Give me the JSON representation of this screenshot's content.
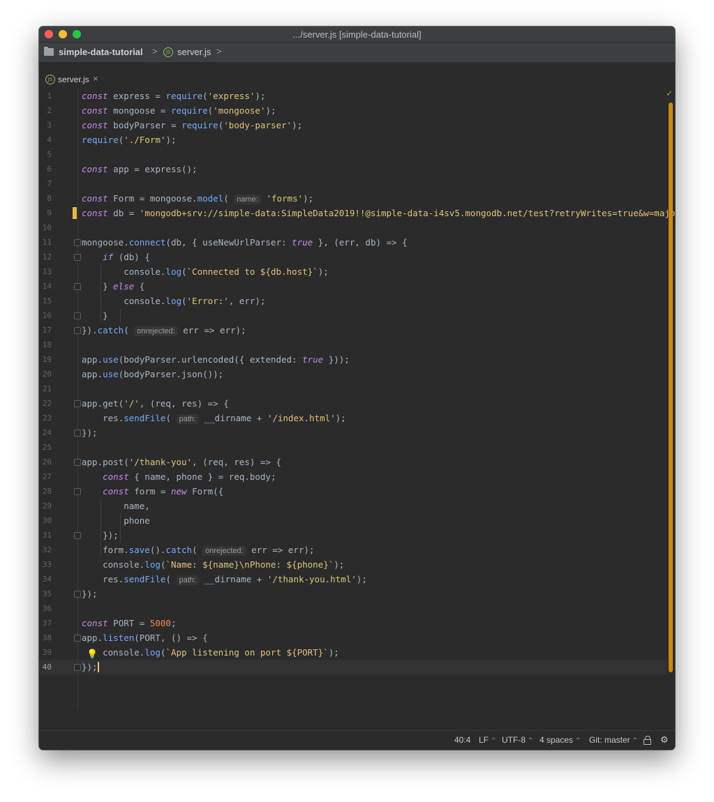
{
  "window": {
    "title": ".../server.js [simple-data-tutorial]"
  },
  "navbar": {
    "project": "simple-data-tutorial",
    "file": "server.js",
    "separator": ">"
  },
  "tab": {
    "label": "server.js",
    "close": "×",
    "icon_text": "JS"
  },
  "editor": {
    "caret_line": 40,
    "lines": [
      "const express = require('express');",
      "const mongoose = require('mongoose');",
      "const bodyParser = require('body-parser');",
      "require('./Form');",
      "",
      "const app = express();",
      "",
      "const Form = mongoose.model( name: 'forms');",
      "const db = 'mongodb+srv://simple-data:SimpleData2019!!@simple-data-i4sv5.mongodb.net/test?retryWrites=true&w=majority';",
      "",
      "mongoose.connect(db, { useNewUrlParser: true }, (err, db) => {",
      "    if (db) {",
      "        console.log(`Connected to ${db.host}`);",
      "    } else {",
      "        console.log('Error:', err);",
      "    }",
      "}).catch( onrejected: err => err);",
      "",
      "app.use(bodyParser.urlencoded({ extended: true }));",
      "app.use(bodyParser.json());",
      "",
      "app.get('/', (req, res) => {",
      "    res.sendFile( path: __dirname + '/index.html');",
      "});",
      "",
      "app.post('/thank-you', (req, res) => {",
      "    const { name, phone } = req.body;",
      "    const form = new Form({",
      "        name,",
      "        phone",
      "    });",
      "    form.save().catch( onrejected: err => err);",
      "    console.log(`Name: ${name}\\nPhone: ${phone}`);",
      "    res.sendFile( path: __dirname + '/thank-you.html');",
      "});",
      "",
      "const PORT = 5000;",
      "app.listen(PORT, () => {",
      "    console.log(`App listening on port ${PORT}`);",
      "});"
    ],
    "line_numbers": [
      "1",
      "2",
      "3",
      "4",
      "5",
      "6",
      "7",
      "8",
      "9",
      "10",
      "11",
      "12",
      "13",
      "14",
      "15",
      "16",
      "17",
      "18",
      "19",
      "20",
      "21",
      "22",
      "23",
      "24",
      "25",
      "26",
      "27",
      "28",
      "29",
      "30",
      "31",
      "32",
      "33",
      "34",
      "35",
      "36",
      "37",
      "38",
      "39",
      "40"
    ]
  },
  "statusbar": {
    "position": "40:4",
    "line_separator": "LF",
    "encoding": "UTF-8",
    "indent": "4 spaces",
    "vcs": "Git: master",
    "chevron": "⌃"
  },
  "colors": {
    "background": "#2b2b2b",
    "keyword": "#c589e6",
    "string": "#e0c47a",
    "function": "#77aaff",
    "parameter": "#f28b54",
    "tab_underline": "#d8405a",
    "scrollbar": "#c88a11",
    "modified_marker": "#e6b84a"
  }
}
